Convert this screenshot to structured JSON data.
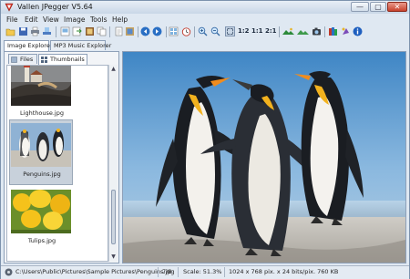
{
  "window": {
    "title": "Vallen JPegger V5.64",
    "minimize_glyph": "—",
    "maximize_glyph": "▢",
    "close_glyph": "✕"
  },
  "menu": [
    "File",
    "Edit",
    "View",
    "Image",
    "Tools",
    "Help"
  ],
  "toolbar": {
    "zoom_levels": [
      "1:2",
      "1:1",
      "2:1"
    ]
  },
  "tabs": [
    {
      "label": "Image Explorer",
      "active": true
    },
    {
      "label": "MP3 Music Explorer",
      "active": false
    }
  ],
  "left_panel": {
    "subtabs": [
      {
        "label": "Files",
        "active": false
      },
      {
        "label": "Thumbnails",
        "active": true
      }
    ],
    "thumbnails": [
      {
        "label": "Lighthouse.jpg",
        "selected": false
      },
      {
        "label": "Penguins.jpg",
        "selected": true
      },
      {
        "label": "Tulips.jpg",
        "selected": false
      }
    ]
  },
  "status": {
    "path": "C:\\Users\\Public\\Pictures\\Sample Pictures\\Penguins.jpg",
    "index": "7/8",
    "scale": "Scale: 51.3%",
    "dimensions": "1024 x 768 pix. x 24 bits/pix. 760 KB"
  },
  "colors": {
    "accent": "#2a6fc4",
    "window_bg": "#dfe8f2"
  }
}
